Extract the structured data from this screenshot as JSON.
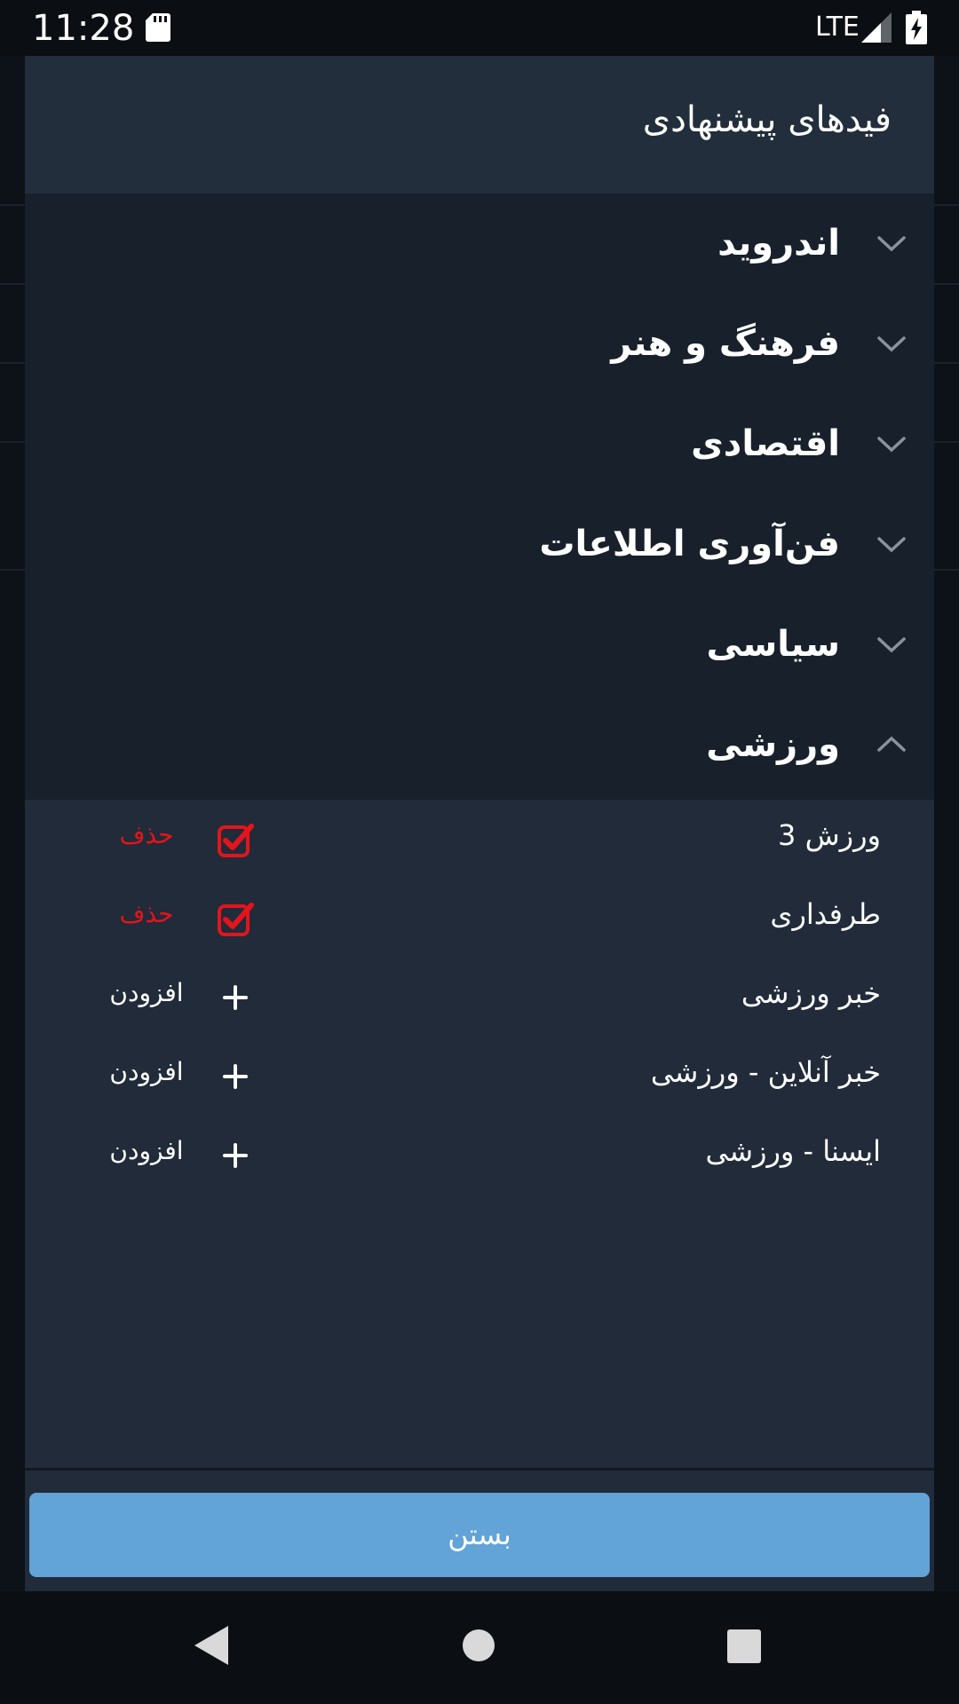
{
  "status_bar": {
    "time": "11:28",
    "network": "LTE",
    "icons": [
      "sd-card-icon",
      "signal-icon",
      "battery-charging-icon"
    ]
  },
  "dialog": {
    "title": "فیدهای پیشنهادی",
    "categories": [
      {
        "label": "اندروید",
        "expanded": false
      },
      {
        "label": "فرهنگ و هنر",
        "expanded": false
      },
      {
        "label": "اقتصادی",
        "expanded": false
      },
      {
        "label": "فن‌آوری اطلاعات",
        "expanded": false
      },
      {
        "label": "سیاسی",
        "expanded": false
      },
      {
        "label": "ورزشی",
        "expanded": true
      }
    ],
    "feeds": [
      {
        "name": "ورزش 3",
        "subscribed": true,
        "action_label": "حذف",
        "icon": "checked-checkbox-icon"
      },
      {
        "name": "طرفداری",
        "subscribed": true,
        "action_label": "حذف",
        "icon": "checked-checkbox-icon"
      },
      {
        "name": "خبر ورزشی",
        "subscribed": false,
        "action_label": "افزودن",
        "icon": "plus-icon"
      },
      {
        "name": "خبر آنلاین - ورزشی",
        "subscribed": false,
        "action_label": "افزودن",
        "icon": "plus-icon"
      },
      {
        "name": "ایسنا - ورزشی",
        "subscribed": false,
        "action_label": "افزودن",
        "icon": "plus-icon"
      }
    ],
    "close_label": "بستن"
  },
  "colors": {
    "accent": "#62a3d8",
    "remove": "#e3141c",
    "header_bg": "#232e3c",
    "category_bg": "#17202b",
    "feed_bg": "#212b39"
  },
  "nav_bar": {
    "icons": [
      "back-icon",
      "home-icon",
      "recents-icon"
    ]
  }
}
